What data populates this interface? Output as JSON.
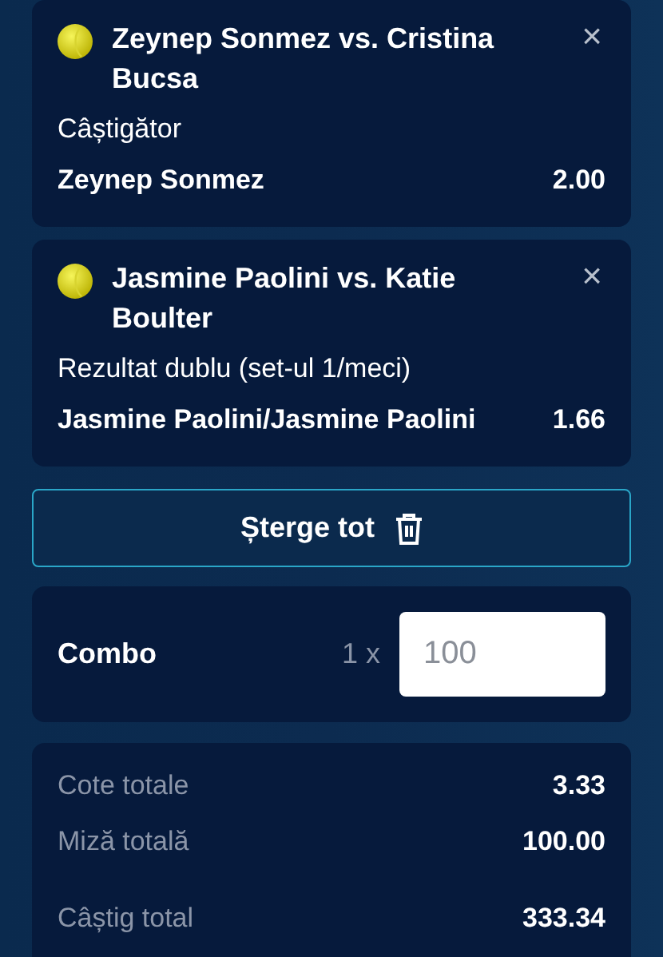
{
  "bets": [
    {
      "match": "Zeynep Sonmez vs. Cristina Bucsa",
      "close": "×",
      "market": "Câștigător",
      "selection": "Zeynep Sonmez",
      "odds": "2.00"
    },
    {
      "match": "Jasmine Paolini vs. Katie Boulter",
      "close": "×",
      "market": "Rezultat dublu (set-ul 1/meci)",
      "selection": "Jasmine Paolini/Jasmine Paolini",
      "odds": "1.66"
    }
  ],
  "clear_button": "Șterge tot",
  "combo": {
    "label": "Combo",
    "multiplier": "1 x",
    "stake": {
      "placeholder": "100"
    }
  },
  "totals": [
    {
      "label": "Cote totale",
      "value": "3.33"
    },
    {
      "label": "Miză totală",
      "value": "100.00"
    },
    {
      "label": "Câștig total",
      "value": "333.34"
    }
  ]
}
